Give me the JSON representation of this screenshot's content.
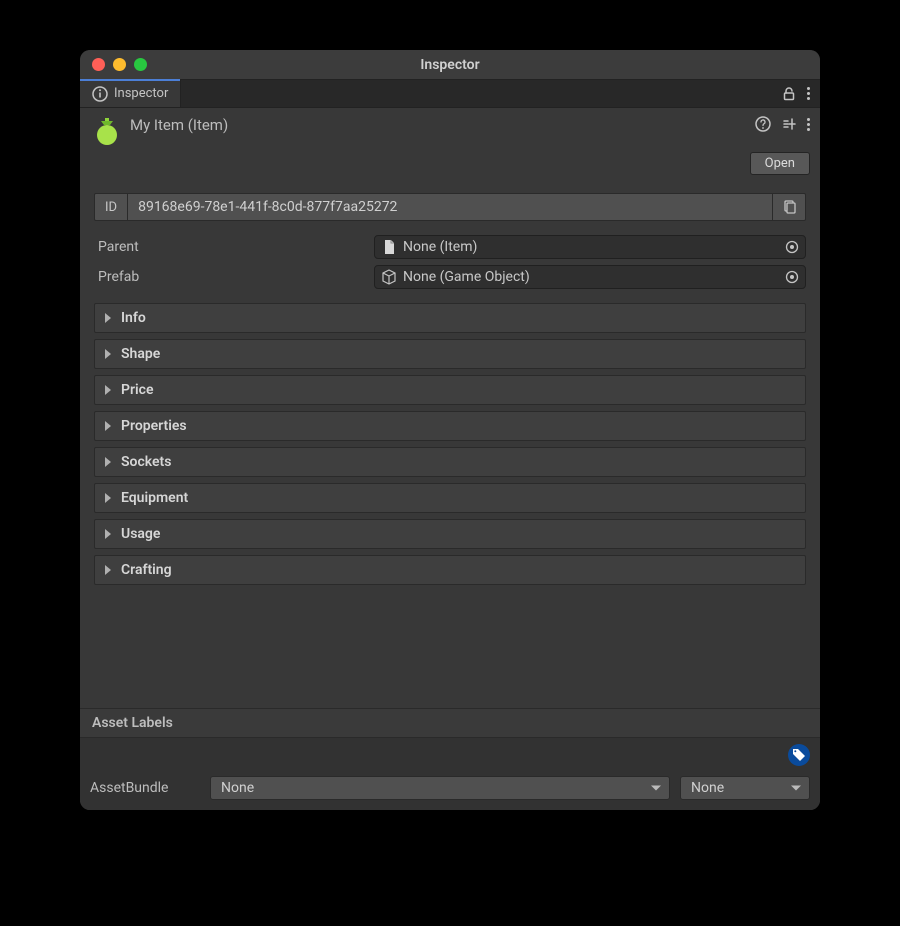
{
  "window": {
    "title": "Inspector"
  },
  "tab": {
    "label": "Inspector"
  },
  "header": {
    "title": "My Item (Item)",
    "open_label": "Open"
  },
  "id": {
    "label": "ID",
    "value": "89168e69-78e1-441f-8c0d-877f7aa25272"
  },
  "fields": {
    "parent": {
      "label": "Parent",
      "value": "None (Item)"
    },
    "prefab": {
      "label": "Prefab",
      "value": "None (Game Object)"
    }
  },
  "foldouts": [
    "Info",
    "Shape",
    "Price",
    "Properties",
    "Sockets",
    "Equipment",
    "Usage",
    "Crafting"
  ],
  "footer": {
    "asset_labels_title": "Asset Labels",
    "asset_bundle_label": "AssetBundle",
    "bundle_value": "None",
    "variant_value": "None"
  }
}
